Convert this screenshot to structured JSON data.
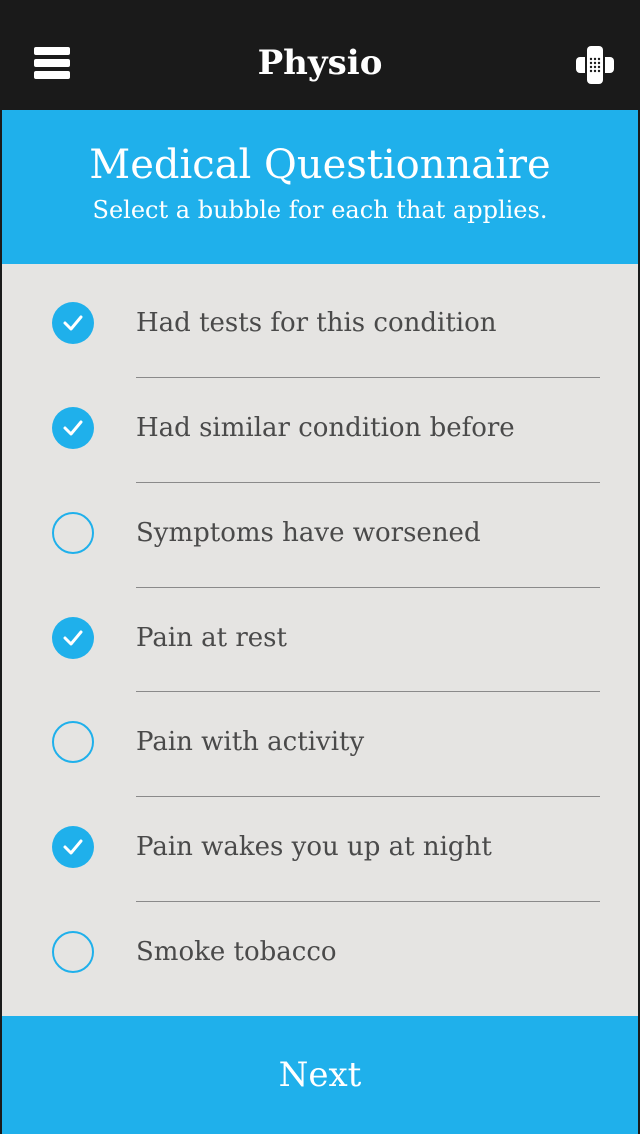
{
  "topbar": {
    "title": "Physio",
    "menu_icon": "menu-icon",
    "action_icon": "bandage-icon"
  },
  "header": {
    "title": "Medical Questionnaire",
    "subtitle": "Select a bubble for each that applies."
  },
  "questions": [
    {
      "label": "Had tests for this condition",
      "checked": true
    },
    {
      "label": "Had similar condition before",
      "checked": true
    },
    {
      "label": "Symptoms have worsened",
      "checked": false
    },
    {
      "label": "Pain at rest",
      "checked": true
    },
    {
      "label": "Pain with activity",
      "checked": false
    },
    {
      "label": "Pain wakes you up at night",
      "checked": true
    },
    {
      "label": "Smoke tobacco",
      "checked": false
    }
  ],
  "footer": {
    "next_label": "Next"
  },
  "colors": {
    "accent": "#1fb0eb",
    "topbar": "#1a1a1a",
    "list_bg": "#e5e4e2",
    "text": "#4a4a4a"
  }
}
